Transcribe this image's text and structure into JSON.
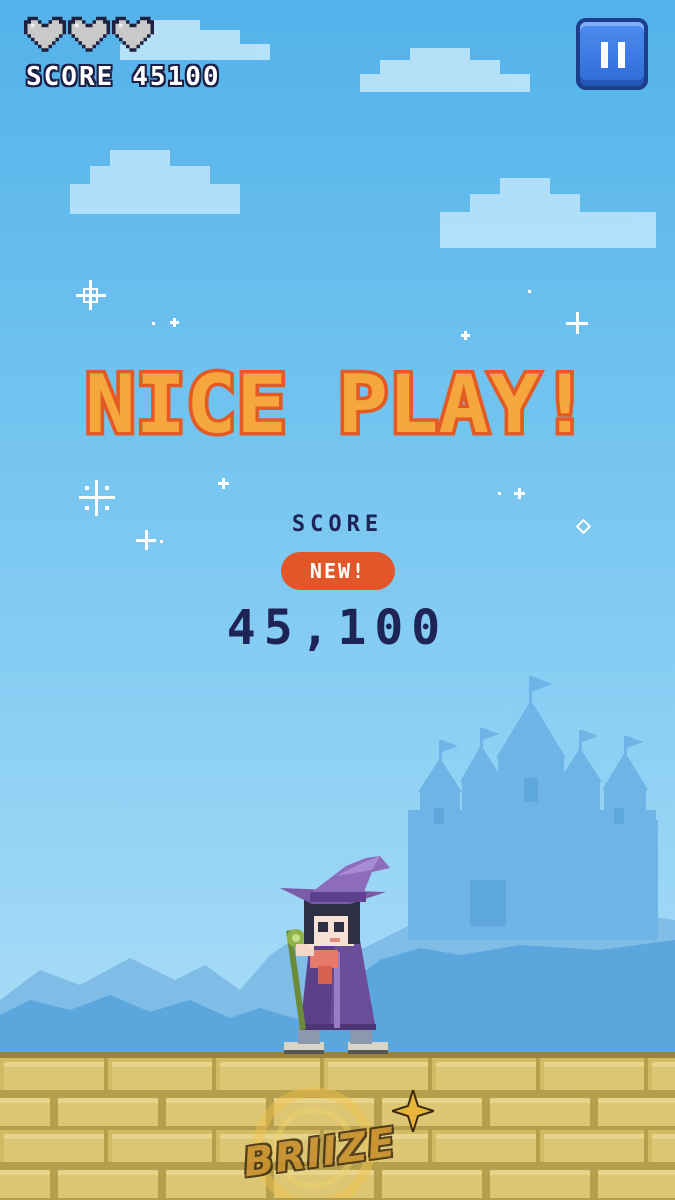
{
  "hud": {
    "lives": {
      "current": 3,
      "max": 3,
      "icon": "heart-icon"
    },
    "score_label": "SCORE",
    "score_value": "45100",
    "pause_icon": "pause-icon"
  },
  "result": {
    "headline": "NICE PLAY!",
    "score_label": "SCORE",
    "new_badge": "NEW!",
    "score_value": "45,100"
  },
  "watermark": {
    "text": "BRIIZE"
  },
  "colors": {
    "sky_top": "#52b2ea",
    "sky_bottom": "#a8dcf6",
    "headline_fill": "#f5a63c",
    "headline_outline": "#e45a24",
    "score_text": "#1e2456",
    "badge": "#e2572a",
    "pause_button": "#3a78e6",
    "brick": "#d6c06a",
    "castle": "#6fb4e6"
  }
}
